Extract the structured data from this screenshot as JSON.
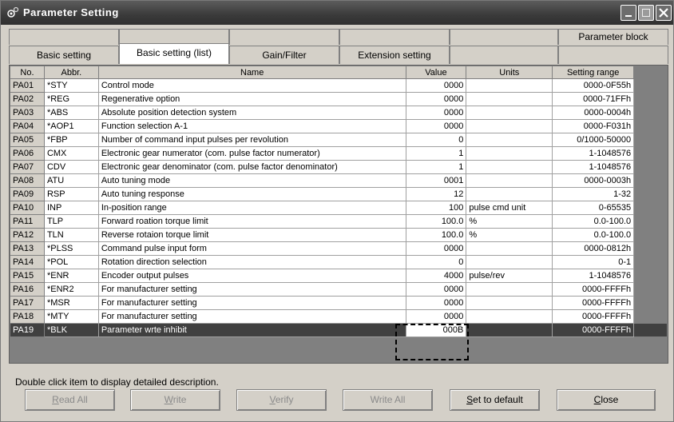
{
  "window": {
    "title": "Parameter Setting"
  },
  "tabs": {
    "top_row": [
      "",
      "",
      "",
      "",
      "",
      "Parameter block"
    ],
    "bottom_row": [
      "Basic setting",
      "Basic setting (list)",
      "Gain/Filter",
      "Extension setting",
      "",
      ""
    ]
  },
  "table": {
    "headers": [
      "No.",
      "Abbr.",
      "Name",
      "Value",
      "Units",
      "Setting range"
    ],
    "rows": [
      {
        "no": "PA01",
        "abbr": "*STY",
        "name": "Control mode",
        "value": "0000",
        "units": "",
        "range": "0000-0F55h"
      },
      {
        "no": "PA02",
        "abbr": "*REG",
        "name": "Regenerative option",
        "value": "0000",
        "units": "",
        "range": "0000-71FFh"
      },
      {
        "no": "PA03",
        "abbr": "*ABS",
        "name": "Absolute position detection system",
        "value": "0000",
        "units": "",
        "range": "0000-0004h"
      },
      {
        "no": "PA04",
        "abbr": "*AOP1",
        "name": "Function selection A-1",
        "value": "0000",
        "units": "",
        "range": "0000-F031h"
      },
      {
        "no": "PA05",
        "abbr": "*FBP",
        "name": "Number of command input pulses per revolution",
        "value": "0",
        "units": "",
        "range": "0/1000-50000"
      },
      {
        "no": "PA06",
        "abbr": "CMX",
        "name": "Electronic gear numerator (com. pulse factor numerator)",
        "value": "1",
        "units": "",
        "range": "1-1048576"
      },
      {
        "no": "PA07",
        "abbr": "CDV",
        "name": "Electronic gear denominator (com. pulse factor denominator)",
        "value": "1",
        "units": "",
        "range": "1-1048576"
      },
      {
        "no": "PA08",
        "abbr": "ATU",
        "name": "Auto tuning mode",
        "value": "0001",
        "units": "",
        "range": "0000-0003h"
      },
      {
        "no": "PA09",
        "abbr": "RSP",
        "name": "Auto tuning response",
        "value": "12",
        "units": "",
        "range": "1-32"
      },
      {
        "no": "PA10",
        "abbr": "INP",
        "name": "In-position range",
        "value": "100",
        "units": "pulse cmd unit",
        "range": "0-65535"
      },
      {
        "no": "PA11",
        "abbr": "TLP",
        "name": "Forward roation torque limit",
        "value": "100.0",
        "units": "%",
        "range": "0.0-100.0"
      },
      {
        "no": "PA12",
        "abbr": "TLN",
        "name": "Reverse rotaion torque limit",
        "value": "100.0",
        "units": "%",
        "range": "0.0-100.0"
      },
      {
        "no": "PA13",
        "abbr": "*PLSS",
        "name": "Command pulse input form",
        "value": "0000",
        "units": "",
        "range": "0000-0812h"
      },
      {
        "no": "PA14",
        "abbr": "*POL",
        "name": "Rotation direction selection",
        "value": "0",
        "units": "",
        "range": "0-1"
      },
      {
        "no": "PA15",
        "abbr": "*ENR",
        "name": "Encoder output pulses",
        "value": "4000",
        "units": "pulse/rev",
        "range": "1-1048576"
      },
      {
        "no": "PA16",
        "abbr": "*ENR2",
        "name": "For manufacturer setting",
        "value": "0000",
        "units": "",
        "range": "0000-FFFFh"
      },
      {
        "no": "PA17",
        "abbr": "*MSR",
        "name": "For manufacturer setting",
        "value": "0000",
        "units": "",
        "range": "0000-FFFFh"
      },
      {
        "no": "PA18",
        "abbr": "*MTY",
        "name": "For manufacturer setting",
        "value": "0000",
        "units": "",
        "range": "0000-FFFFh"
      },
      {
        "no": "PA19",
        "abbr": "*BLK",
        "name": "Parameter wrte inhibit",
        "value": "000B",
        "units": "",
        "range": "0000-FFFFh"
      }
    ]
  },
  "status_text": "Double click item to display detailed description.",
  "buttons": [
    {
      "label": "Read All",
      "mnemonic": "R",
      "rest": "ead All",
      "enabled": false
    },
    {
      "label": "Write",
      "mnemonic": "W",
      "rest": "rite",
      "enabled": false
    },
    {
      "label": "Verify",
      "mnemonic": "V",
      "rest": "erify",
      "enabled": false
    },
    {
      "label": "Write All",
      "mnemonic": "",
      "rest": "Write All",
      "enabled": false
    },
    {
      "label": "Set to default",
      "mnemonic": "S",
      "rest": "et to default",
      "enabled": true
    },
    {
      "label": "Close",
      "mnemonic": "C",
      "rest": "lose",
      "enabled": true
    }
  ]
}
